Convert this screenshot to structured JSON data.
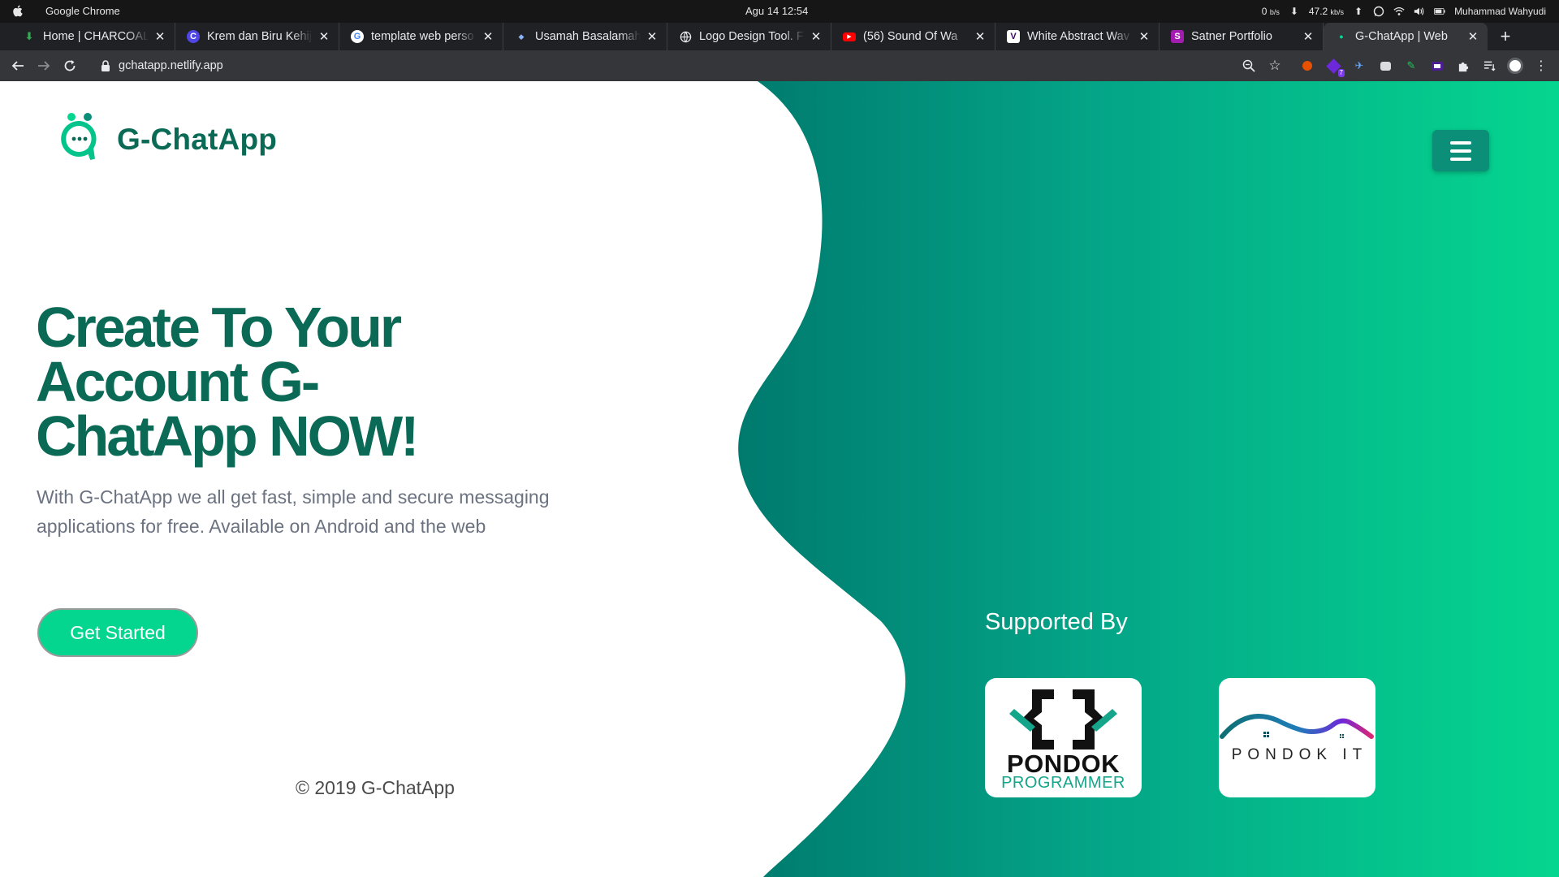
{
  "os": {
    "app_name": "Google Chrome",
    "clock": "Agu 14  12:54",
    "net_up_value": "0",
    "net_up_unit": "b/s",
    "net_down_value": "47.2",
    "net_down_unit": "kb/s",
    "user": "Muhammad Wahyudi"
  },
  "tabs": [
    {
      "title": "Home | CHARCOALN",
      "favicon": "download-icon",
      "color": "#34a853"
    },
    {
      "title": "Krem dan Biru Kehija",
      "favicon": "canva-icon",
      "color": "#4f46e5"
    },
    {
      "title": "template web perso",
      "favicon": "google-icon",
      "color": "#ffffff"
    },
    {
      "title": "Usamah Basalamah",
      "favicon": "site-icon",
      "color": "#8ab4f8"
    },
    {
      "title": "Logo Design Tool. Fr",
      "favicon": "globe-icon",
      "color": "#e8eaed"
    },
    {
      "title": "(56) Sound Of Wa",
      "favicon": "youtube-icon",
      "color": "#ff0000"
    },
    {
      "title": "White Abstract Wav",
      "favicon": "vecteezy-icon",
      "color": "#5b21b6"
    },
    {
      "title": "Satner Portfolio",
      "favicon": "s-icon",
      "color": "#a21caf"
    },
    {
      "title": "G-ChatApp | Web",
      "favicon": "gchat-icon",
      "color": "#05d68f"
    }
  ],
  "toolbar": {
    "url": "gchatapp.netlify.app",
    "ext_badge": "7"
  },
  "page": {
    "brand": "G-ChatApp",
    "hero_title": "Create To Your Account G-ChatApp NOW!",
    "hero_desc": "With G-ChatApp we all get fast, simple and secure messaging applications for free. Available on Android and the web",
    "cta_label": "Get Started",
    "copyright": "© 2019 G-ChatApp",
    "supported_by": "Supported By",
    "sponsor1_line1": "PONDOK",
    "sponsor1_line2": "PROGRAMMER",
    "sponsor2_text": "PONDOK IT"
  },
  "colors": {
    "brand_dark": "#0a6a55",
    "brand_green": "#05d68f",
    "gradient_from": "#007a6e",
    "gradient_to": "#05d68f"
  }
}
